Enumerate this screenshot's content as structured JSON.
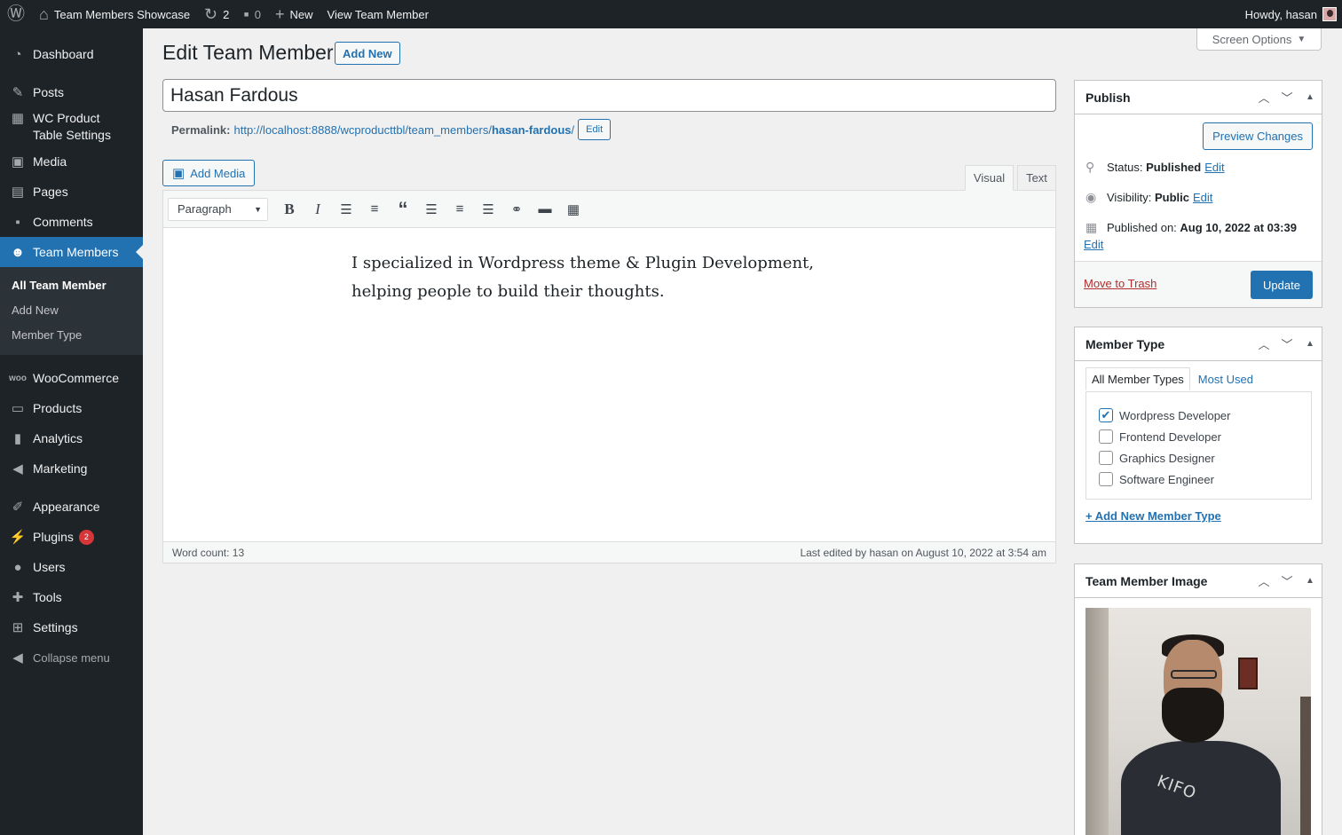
{
  "admin_bar": {
    "site_name": "Team Members Showcase",
    "updates_count": "2",
    "comments_count": "0",
    "new_label": "New",
    "view_label": "View Team Member",
    "howdy": "Howdy, hasan"
  },
  "sidebar": {
    "items": [
      {
        "label": "Dashboard",
        "icon": "dashboard-icon"
      },
      {
        "label": "Posts",
        "icon": "pin-icon"
      },
      {
        "label": "WC Product Table Settings",
        "icon": "table-icon"
      },
      {
        "label": "Media",
        "icon": "media-icon"
      },
      {
        "label": "Pages",
        "icon": "pages-icon"
      },
      {
        "label": "Comments",
        "icon": "comment-icon"
      },
      {
        "label": "Team Members",
        "icon": "groups-icon"
      },
      {
        "label": "WooCommerce",
        "icon": "woo-icon"
      },
      {
        "label": "Products",
        "icon": "archive-icon"
      },
      {
        "label": "Analytics",
        "icon": "chart-icon"
      },
      {
        "label": "Marketing",
        "icon": "megaphone-icon"
      },
      {
        "label": "Appearance",
        "icon": "brush-icon"
      },
      {
        "label": "Plugins",
        "icon": "plugin-icon"
      },
      {
        "label": "Users",
        "icon": "user-icon"
      },
      {
        "label": "Tools",
        "icon": "wrench-icon"
      },
      {
        "label": "Settings",
        "icon": "settings-icon"
      }
    ],
    "plugins_badge": "2",
    "submenu": [
      "All Team Member",
      "Add New",
      "Member Type"
    ],
    "collapse_label": "Collapse menu"
  },
  "screen_options": "Screen Options",
  "page": {
    "title": "Edit Team Member",
    "add_new": "Add New",
    "post_title": "Hasan Fardous",
    "permalink_label": "Permalink:",
    "permalink_base": "http://localhost:8888/wcproducttbl/team_members/",
    "permalink_slug": "hasan-fardous",
    "permalink_end": "/",
    "permalink_edit": "Edit"
  },
  "editor": {
    "add_media": "Add Media",
    "tab_visual": "Visual",
    "tab_text": "Text",
    "format": "Paragraph",
    "content": "I specialized in Wordpress theme & Plugin Development, helping people to build their thoughts.",
    "word_count": "Word count: 13",
    "last_edited": "Last edited by hasan on August 10, 2022 at 3:54 am"
  },
  "publish": {
    "heading": "Publish",
    "preview": "Preview Changes",
    "status_label": "Status:",
    "status_value": "Published",
    "visibility_label": "Visibility:",
    "visibility_value": "Public",
    "published_label": "Published on:",
    "published_value": "Aug 10, 2022 at 03:39",
    "edit": "Edit",
    "trash": "Move to Trash",
    "update": "Update"
  },
  "member_type": {
    "heading": "Member Type",
    "tab_all": "All Member Types",
    "tab_most_used": "Most Used",
    "options": [
      {
        "label": "Wordpress Developer",
        "checked": true
      },
      {
        "label": "Frontend Developer",
        "checked": false
      },
      {
        "label": "Graphics Designer",
        "checked": false
      },
      {
        "label": "Software Engineer",
        "checked": false
      }
    ],
    "add_new": "+ Add New Member Type"
  },
  "member_image": {
    "heading": "Team Member Image",
    "shirt_text": "KIFO"
  },
  "colors": {
    "admin_bar": "#1d2327",
    "accent": "#2271b1",
    "danger": "#d63638"
  }
}
